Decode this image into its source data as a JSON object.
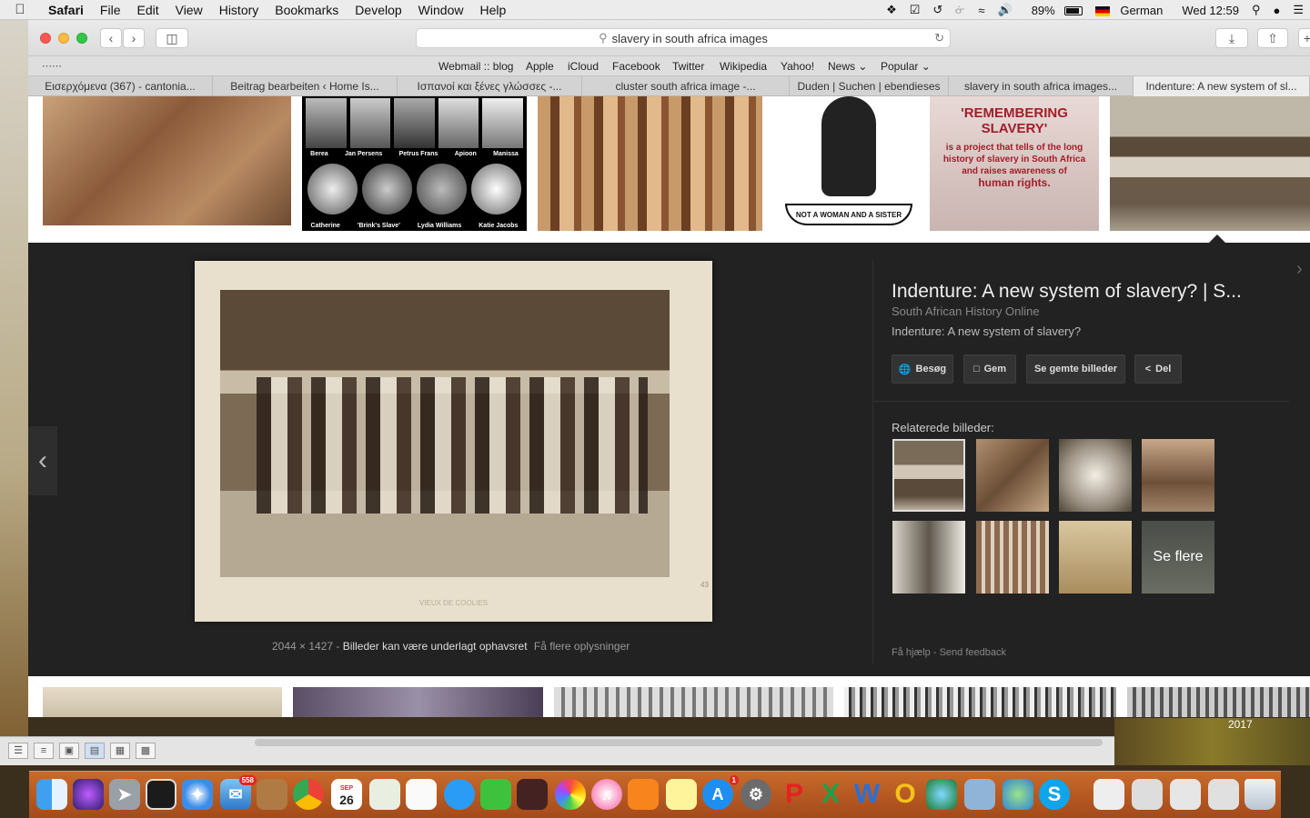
{
  "menubar": {
    "app": "Safari",
    "items": [
      "File",
      "Edit",
      "View",
      "History",
      "Bookmarks",
      "Develop",
      "Window",
      "Help"
    ],
    "battery": "89%",
    "input_lang": "German",
    "clock": "Wed 12:59"
  },
  "toolbar": {
    "url": "slavery in south africa images"
  },
  "favorites": [
    "Webmail :: blog",
    "Apple",
    "iCloud",
    "Facebook",
    "Twitter",
    "Wikipedia",
    "Yahoo!",
    "News",
    "Popular"
  ],
  "tabs": [
    "Εισερχόμενα (367) - cantonia...",
    "Beitrag bearbeiten ‹ Home Is...",
    "Ισπανοί και ξένες γλώσσες -...",
    "cluster south africa image -...",
    "Duden | Suchen | ebendieses",
    "slavery in south africa images...",
    "Indenture: A new system of sl..."
  ],
  "thumbs": {
    "t2": {
      "top": [
        "Berea",
        "Jan Persens",
        "Petrus Frans",
        "Apioon",
        "Manissa"
      ],
      "bottom": [
        "Catherine",
        "'Brink's Slave'",
        "Lydia Williams",
        "Katie Jacobs"
      ]
    },
    "t4": "NOT A WOMAN AND A SISTER",
    "t5": {
      "title": "'REMEMBERING SLAVERY'",
      "line1": "is a project that tells of the long",
      "line2": "history of slavery in South Africa",
      "line3": "and raises awareness of",
      "line4": "human rights."
    }
  },
  "viewer": {
    "photo_label": "VIEUX DE COOLIES",
    "photo_number": "43",
    "caption": {
      "dims": "2044 × 1427",
      "sep": "-",
      "rights": "Billeder kan være underlagt ophavsret",
      "more": "Få flere oplysninger"
    },
    "title": "Indenture: A new system of slavery? | S...",
    "source": "South African History Online",
    "description": "Indenture: A new system of slavery?",
    "buttons": {
      "visit": "Besøg",
      "save": "Gem",
      "saved": "Se gemte billeder",
      "share": "Del"
    },
    "related_label": "Relaterede billeder:",
    "see_more": "Se flere",
    "footer": {
      "help": "Få hjælp",
      "sep": "-",
      "feedback": "Send feedback"
    }
  },
  "desktop": {
    "year": "2017"
  },
  "dock": {
    "mail_badge": "558",
    "calendar_month": "SEP",
    "calendar_day": "26",
    "appstore_badge": "1"
  },
  "colors": {
    "viewer_bg": "#222222",
    "dock": "#b8561f"
  }
}
